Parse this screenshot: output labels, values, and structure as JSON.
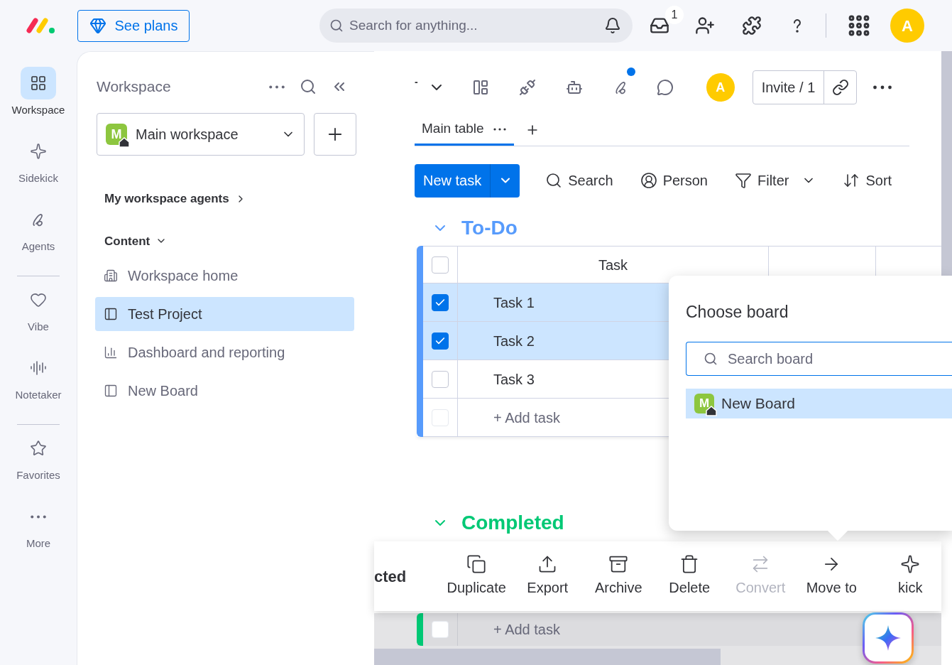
{
  "top_bar": {
    "see_plans": "See plans",
    "search_placeholder": "Search for anything...",
    "inbox_badge": "1",
    "avatar": "A"
  },
  "rail": [
    {
      "label": "Workspace",
      "kind": "workspace",
      "selected": true
    },
    {
      "label": "Sidekick",
      "kind": "sidekick",
      "selected": false
    },
    {
      "label": "Agents",
      "kind": "agents",
      "selected": false
    },
    {
      "kind": "divider"
    },
    {
      "label": "Vibe",
      "kind": "vibe",
      "selected": false
    },
    {
      "label": "Notetaker",
      "kind": "notetaker",
      "selected": false
    },
    {
      "kind": "divider"
    },
    {
      "label": "Favorites",
      "kind": "favorites",
      "selected": false
    },
    {
      "label": "More",
      "kind": "more",
      "selected": false
    }
  ],
  "sidebar": {
    "title": "Workspace",
    "workspace": "Main workspace",
    "workspace_initial": "M",
    "agents_link": "My workspace agents",
    "content_label": "Content",
    "items": [
      {
        "label": "Workspace home",
        "kind": "home",
        "selected": false
      },
      {
        "label": "Test Project",
        "kind": "board",
        "selected": true
      },
      {
        "label": "Dashboard and reporting",
        "kind": "dashboard",
        "selected": false
      },
      {
        "label": "New Board",
        "kind": "board",
        "selected": false
      }
    ]
  },
  "board": {
    "title": "-",
    "avatar": "A",
    "invite": "Invite / 1",
    "notification_dot": true,
    "tabs": [
      {
        "label": "Main table",
        "selected": true
      }
    ],
    "new_task": "New task",
    "tools": [
      {
        "label": "Search",
        "kind": "search"
      },
      {
        "label": "Person",
        "kind": "person"
      },
      {
        "label": "Filter",
        "kind": "filter"
      },
      {
        "label": "Sort",
        "kind": "sort"
      }
    ]
  },
  "groups": [
    {
      "title": "To-Do",
      "color": "#579bfc",
      "columns": [
        "Task"
      ],
      "header_checked": false,
      "rows": [
        {
          "task": "Task 1",
          "checked": true
        },
        {
          "task": "Task 2",
          "checked": true
        },
        {
          "task": "Task 3",
          "checked": false
        }
      ],
      "add_task": "+ Add task",
      "add_checked": false
    },
    {
      "title": "Completed",
      "color": "#00c875",
      "add_task": "+ Add task",
      "add_checked": false
    }
  ],
  "choose_board": {
    "title": "Choose board",
    "search_placeholder": "Search board",
    "boards": [
      {
        "label": "New Board",
        "initial": "M",
        "selected": true
      }
    ]
  },
  "action_bar": {
    "label": "cted",
    "actions": [
      {
        "label": "Duplicate",
        "kind": "duplicate",
        "disabled": false
      },
      {
        "label": "Export",
        "kind": "export",
        "disabled": false
      },
      {
        "label": "Archive",
        "kind": "archive",
        "disabled": false
      },
      {
        "label": "Delete",
        "kind": "delete",
        "disabled": false
      },
      {
        "label": "Convert",
        "kind": "convert",
        "disabled": true
      },
      {
        "label": "Move to",
        "kind": "move",
        "disabled": false
      },
      {
        "label": "kick",
        "kind": "sidekick",
        "disabled": false
      }
    ]
  }
}
